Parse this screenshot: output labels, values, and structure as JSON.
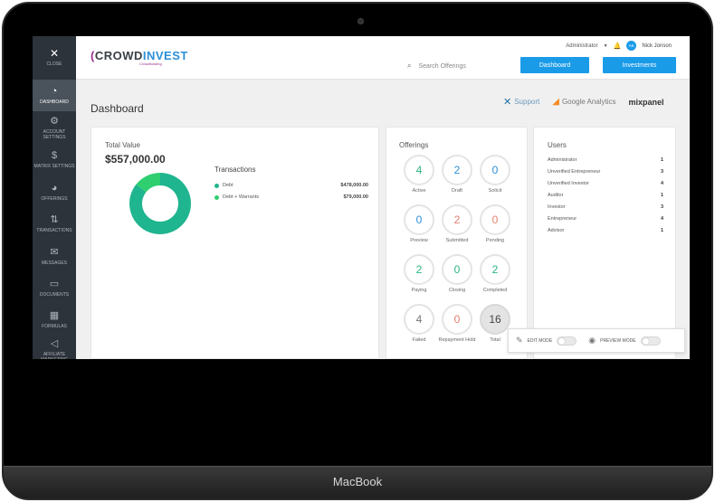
{
  "device": {
    "label": "MacBook"
  },
  "sidebar": {
    "close_label": "CLOSE",
    "items": [
      {
        "label": "DASHBOARD",
        "icon": "gauge-icon"
      },
      {
        "label": "ACCOUNT SETTINGS",
        "icon": "gear-icon"
      },
      {
        "label": "MATRIX SETTINGS",
        "icon": "dollar-icon"
      },
      {
        "label": "OFFERINGS",
        "icon": "pie-icon"
      },
      {
        "label": "TRANSACTIONS",
        "icon": "transfer-icon"
      },
      {
        "label": "MESSAGES",
        "icon": "envelope-icon"
      },
      {
        "label": "DOCUMENTS",
        "icon": "folder-icon"
      },
      {
        "label": "FORMULAS",
        "icon": "calculator-icon"
      },
      {
        "label": "AFFILIATE MARKETING",
        "icon": "megaphone-icon"
      }
    ]
  },
  "header": {
    "logo": {
      "part1": "CROWD",
      "part2": "INVEST",
      "sub": "Crowdfunding"
    },
    "role": "Administrator",
    "user_initials": "AK",
    "user_name": "Nick Jonson",
    "search_placeholder": "Search Offerings",
    "btn_dashboard": "Dashboard",
    "btn_investments": "Investments"
  },
  "page": {
    "title": "Dashboard",
    "integrations": {
      "support": "Support",
      "ga": "Google Analytics",
      "mixpanel": "mixpanel"
    }
  },
  "total_value": {
    "label": "Total Value",
    "value": "$557,000.00",
    "transactions_title": "Transactions",
    "rows": [
      {
        "name": "Debt",
        "amount": "$478,000.00",
        "color": "#1fb58f"
      },
      {
        "name": "Debt + Warrants",
        "amount": "$79,000.00",
        "color": "#2fcf6f"
      }
    ]
  },
  "chart_data": {
    "type": "pie",
    "labels": [
      "Debt",
      "Debt + Warrants"
    ],
    "values": [
      478000,
      79000
    ],
    "colors": [
      "#1fb58f",
      "#2fcf6f"
    ]
  },
  "offerings": {
    "title": "Offerings",
    "items": [
      {
        "label": "Active",
        "value": "4",
        "tone": "green"
      },
      {
        "label": "Draft",
        "value": "2",
        "tone": "blue"
      },
      {
        "label": "Solicit",
        "value": "0",
        "tone": "blue"
      },
      {
        "label": "Preview",
        "value": "0",
        "tone": "blue"
      },
      {
        "label": "Submitted",
        "value": "2",
        "tone": "red"
      },
      {
        "label": "Pending",
        "value": "0",
        "tone": "red"
      },
      {
        "label": "Paying",
        "value": "2",
        "tone": "green"
      },
      {
        "label": "Closing",
        "value": "0",
        "tone": "green"
      },
      {
        "label": "Completed",
        "value": "2",
        "tone": "green"
      },
      {
        "label": "Failed",
        "value": "4",
        "tone": "gray"
      },
      {
        "label": "Repayment Hold",
        "value": "0",
        "tone": "red"
      },
      {
        "label": "Total",
        "value": "16",
        "tone": "total"
      }
    ]
  },
  "users": {
    "title": "Users",
    "rows": [
      {
        "name": "Administrator",
        "count": "1"
      },
      {
        "name": "Unverified Entrepreneur",
        "count": "3"
      },
      {
        "name": "Unverified Investor",
        "count": "4"
      },
      {
        "name": "Auditor",
        "count": "1"
      },
      {
        "name": "Investor",
        "count": "3"
      },
      {
        "name": "Entrepreneur",
        "count": "4"
      },
      {
        "name": "Advisor",
        "count": "1"
      }
    ]
  },
  "modes": {
    "edit": "EDIT MODE",
    "preview": "PREVIEW MODE"
  }
}
